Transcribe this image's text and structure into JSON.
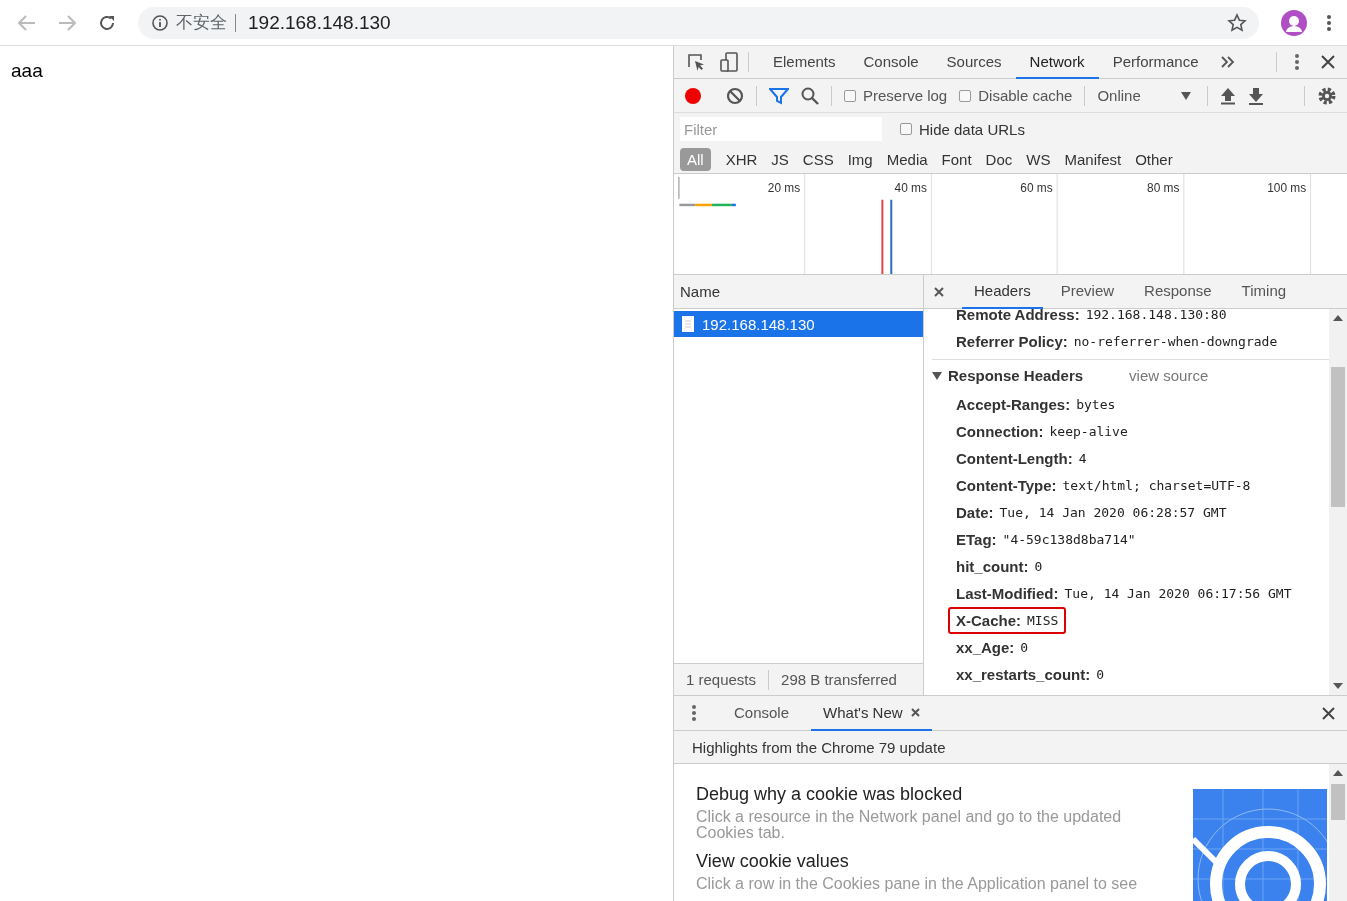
{
  "browser": {
    "security_label": "不安全",
    "url": "192.168.148.130"
  },
  "page": {
    "text": "aaa"
  },
  "devtools": {
    "tabs": [
      {
        "label": "Elements",
        "selected": false
      },
      {
        "label": "Console",
        "selected": false
      },
      {
        "label": "Sources",
        "selected": false
      },
      {
        "label": "Network",
        "selected": true
      },
      {
        "label": "Performance",
        "selected": false
      }
    ]
  },
  "network": {
    "recording": true,
    "preserve_log": {
      "label": "Preserve log",
      "checked": false
    },
    "disable_cache": {
      "label": "Disable cache",
      "checked": false
    },
    "throttling": "Online",
    "filter": {
      "placeholder": "Filter"
    },
    "hide_data_urls": {
      "label": "Hide data URLs",
      "checked": false
    },
    "types": [
      {
        "label": "All",
        "selected": true
      },
      {
        "label": "XHR",
        "selected": false
      },
      {
        "label": "JS",
        "selected": false
      },
      {
        "label": "CSS",
        "selected": false
      },
      {
        "label": "Img",
        "selected": false
      },
      {
        "label": "Media",
        "selected": false
      },
      {
        "label": "Font",
        "selected": false
      },
      {
        "label": "Doc",
        "selected": false
      },
      {
        "label": "WS",
        "selected": false
      },
      {
        "label": "Manifest",
        "selected": false
      },
      {
        "label": "Other",
        "selected": false
      }
    ],
    "timeline_ticks": [
      "20 ms",
      "40 ms",
      "60 ms",
      "80 ms",
      "100 ms"
    ],
    "name_column": "Name",
    "requests": [
      {
        "name": "192.168.148.130",
        "selected": true
      }
    ],
    "summary": [
      "1 requests",
      "298 B transferred"
    ],
    "detail_tabs": [
      {
        "label": "Headers",
        "selected": true
      },
      {
        "label": "Preview",
        "selected": false
      },
      {
        "label": "Response",
        "selected": false
      },
      {
        "label": "Timing",
        "selected": false
      }
    ],
    "general": [
      {
        "name": "Remote Address:",
        "value": "192.168.148.130:80"
      },
      {
        "name": "Referrer Policy:",
        "value": "no-referrer-when-downgrade"
      }
    ],
    "response_headers": {
      "title": "Response Headers",
      "expanded": true,
      "view_source": "view source",
      "items": [
        {
          "name": "Accept-Ranges:",
          "value": "bytes",
          "highlighted": false
        },
        {
          "name": "Connection:",
          "value": "keep-alive",
          "highlighted": false
        },
        {
          "name": "Content-Length:",
          "value": "4",
          "highlighted": false
        },
        {
          "name": "Content-Type:",
          "value": "text/html; charset=UTF-8",
          "highlighted": false
        },
        {
          "name": "Date:",
          "value": "Tue, 14 Jan 2020 06:28:57 GMT",
          "highlighted": false
        },
        {
          "name": "ETag:",
          "value": "\"4-59c138d8ba714\"",
          "highlighted": false
        },
        {
          "name": "hit_count:",
          "value": "0",
          "highlighted": false
        },
        {
          "name": "Last-Modified:",
          "value": "Tue, 14 Jan 2020 06:17:56 GMT",
          "highlighted": false
        },
        {
          "name": "X-Cache:",
          "value": "MISS",
          "highlighted": true
        },
        {
          "name": "xx_Age:",
          "value": "0",
          "highlighted": false
        },
        {
          "name": "xx_restarts_count:",
          "value": "0",
          "highlighted": false
        }
      ]
    }
  },
  "drawer": {
    "tabs": [
      {
        "label": "Console",
        "selected": false,
        "closable": false
      },
      {
        "label": "What's New",
        "selected": true,
        "closable": true
      }
    ],
    "subtitle": "Highlights from the Chrome 79 update",
    "items": [
      {
        "title": "Debug why a cookie was blocked",
        "description": "Click a resource in the Network panel and go to the updated Cookies tab."
      },
      {
        "title": "View cookie values",
        "description": "Click a row in the Cookies pane in the Application panel to see"
      }
    ]
  }
}
